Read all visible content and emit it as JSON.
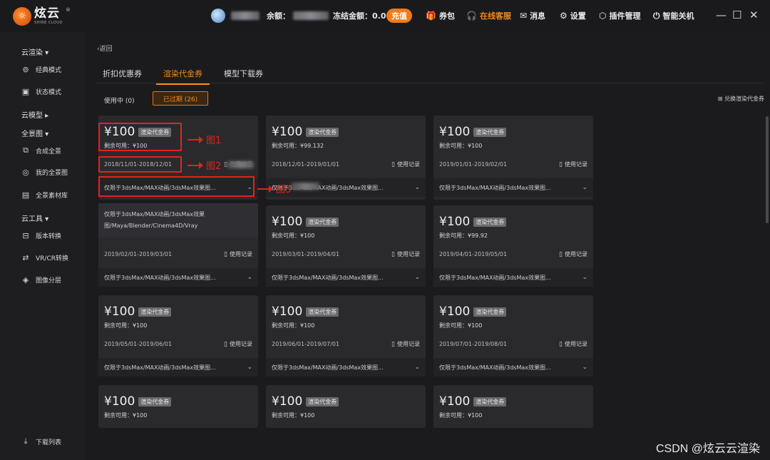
{
  "app": {
    "logo_cn": "炫云",
    "logo_en": "SHINE CLOUD"
  },
  "topbar": {
    "balance_label": "余额：",
    "frozen_label": "冻结金额：0.0",
    "recharge": "充值",
    "nav": [
      {
        "label": "券包",
        "icon": "gift-icon"
      },
      {
        "label": "在线客服",
        "icon": "headset-icon"
      },
      {
        "label": "消息",
        "icon": "mail-icon"
      },
      {
        "label": "设置",
        "icon": "settings-icon"
      },
      {
        "label": "插件管理",
        "icon": "plugin-icon"
      },
      {
        "label": "智能关机",
        "icon": "power-icon"
      }
    ]
  },
  "sidebar": {
    "group_cloud_render": "云渲染 ▾",
    "item_classic": "经典模式",
    "item_status": "状态模式",
    "group_cloud_model": "云模型 ▸",
    "group_panorama": "全景图 ▾",
    "item_compose": "合成全景",
    "item_my_panorama": "我的全景图",
    "item_panorama_assets": "全景素材库",
    "group_tools": "云工具 ▾",
    "item_version": "版本转换",
    "item_vrcr": "VR/CR转换",
    "item_layer": "图像分层",
    "download_list": "下载列表"
  },
  "main": {
    "back": "‹返回",
    "tabs": [
      "折扣优惠券",
      "渲染代金券",
      "模型下载券"
    ],
    "filter_in_use": "使用中 (0)",
    "filter_expired": "已过期 (26)",
    "exchange": "兑换渲染代金券",
    "expanded_text": "仅限于3dsMax/MAX动画/3dsMax效果图/Maya/Blender/Cinema4D/Vray"
  },
  "card_common": {
    "tag": "渲染代金券",
    "record": "使用记录",
    "desc": "仅限于3dsMax/MAX动画/3dsMax效果图..."
  },
  "cards": [
    {
      "amount": "¥100",
      "remain": "剩余可用：¥100",
      "date": "2018/11/01-2018/12/01"
    },
    {
      "amount": "¥100",
      "remain": "剩余可用：¥99.132",
      "date": "2018/12/01-2019/01/01"
    },
    {
      "amount": "¥100",
      "remain": "剩余可用：¥100",
      "date": "2019/01/01-2019/02/01"
    },
    {
      "amount": "",
      "remain": "",
      "date": "2019/02/01-2019/03/01"
    },
    {
      "amount": "¥100",
      "remain": "剩余可用：¥100",
      "date": "2019/03/01-2019/04/01"
    },
    {
      "amount": "¥100",
      "remain": "剩余可用：¥99.92",
      "date": "2019/04/01-2019/05/01"
    },
    {
      "amount": "¥100",
      "remain": "剩余可用：¥100",
      "date": "2019/05/01-2019/06/01"
    },
    {
      "amount": "¥100",
      "remain": "剩余可用：¥100",
      "date": "2019/06/01-2019/07/01"
    },
    {
      "amount": "¥100",
      "remain": "剩余可用：¥100",
      "date": "2019/07/01-2019/08/01"
    },
    {
      "amount": "¥100",
      "remain": "剩余可用：¥100",
      "date": ""
    },
    {
      "amount": "¥100",
      "remain": "剩余可用：¥100",
      "date": ""
    },
    {
      "amount": "¥100",
      "remain": "剩余可用：¥100",
      "date": ""
    }
  ],
  "annotations": [
    "图1",
    "图2",
    "图3"
  ],
  "watermark": "CSDN @炫云云渲染",
  "colors": {
    "accent": "#f08a20",
    "annotation": "#e0231d"
  }
}
